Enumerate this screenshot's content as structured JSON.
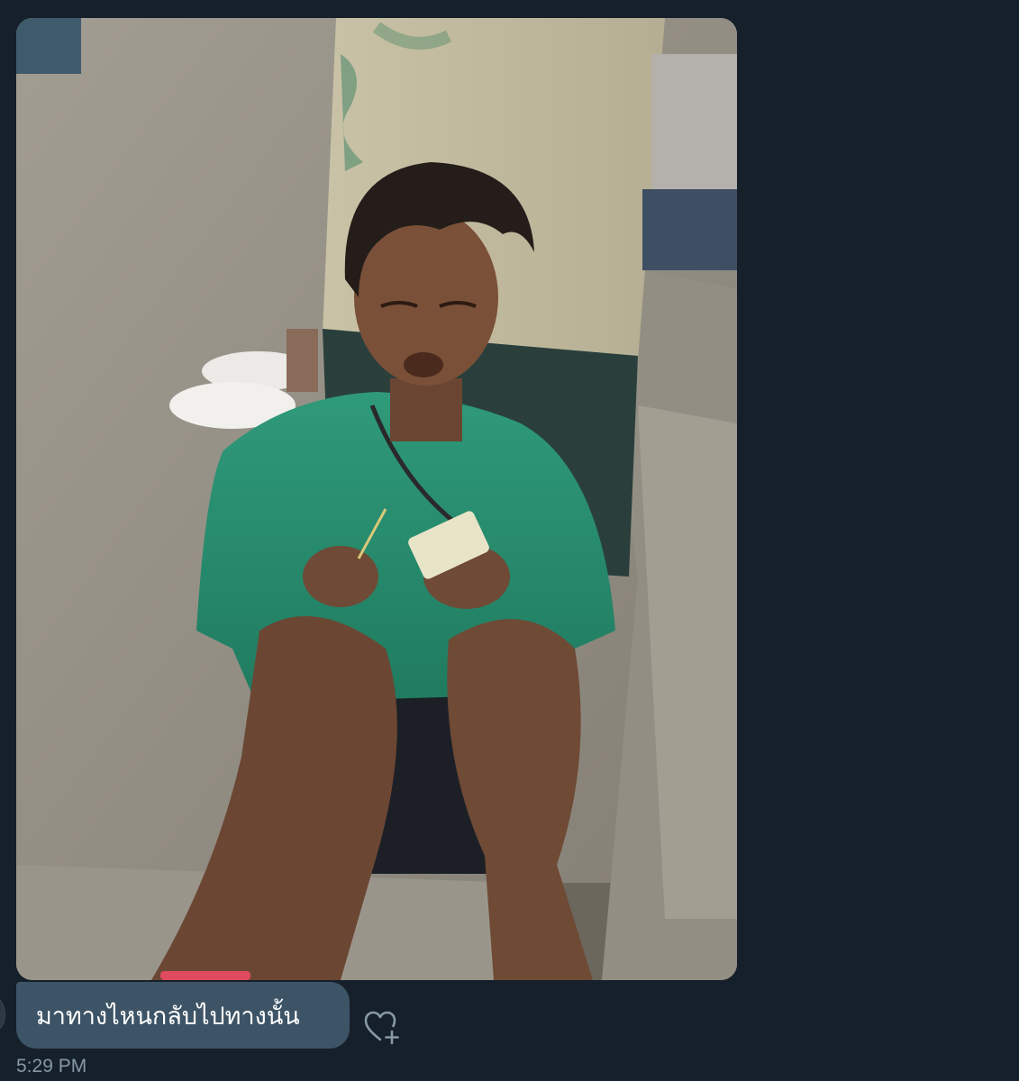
{
  "message": {
    "text": "มาทางไหนกลับไปทางนั้น",
    "timestamp": "5:29 PM"
  },
  "media": {
    "type": "photo",
    "alt": "attached photo"
  },
  "icons": {
    "react": "heart-plus-icon",
    "avatar": "avatar"
  },
  "colors": {
    "background": "#15202b",
    "bubble": "#3d5466",
    "timestamp": "#8899a6"
  }
}
